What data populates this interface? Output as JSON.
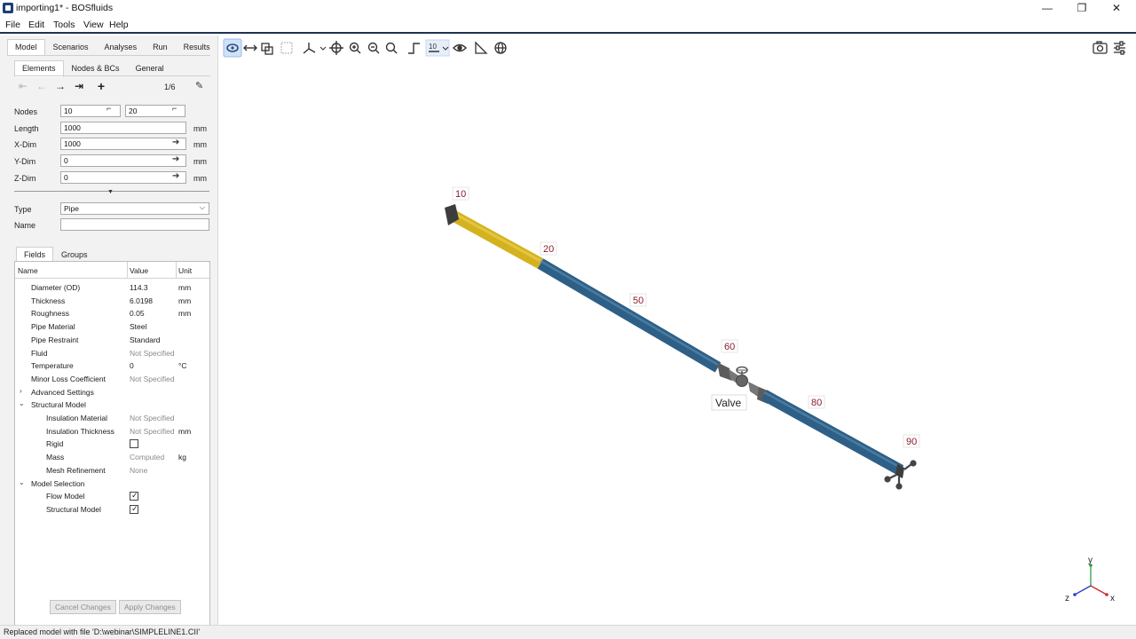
{
  "window": {
    "title": "importing1* - BOSfluids",
    "minimize_glyph": "—",
    "maximize_glyph": "❐",
    "close_glyph": "✕"
  },
  "menu": [
    "File",
    "Edit",
    "Tools",
    "View",
    "Help"
  ],
  "left_panel": {
    "main_tabs": [
      "Model",
      "Scenarios",
      "Analyses",
      "Run",
      "Results"
    ],
    "sub_tabs": [
      "Elements",
      "Nodes & BCs",
      "General"
    ],
    "nav": {
      "first": "⇤",
      "prev": "←",
      "next": "→",
      "last": "⇥",
      "add": "+",
      "counter": "1/6",
      "edit": "✎"
    },
    "element": {
      "nodes_label": "Nodes",
      "node_from": "10",
      "node_to": "20",
      "length_label": "Length",
      "length": "1000",
      "length_unit": "mm",
      "xdim_label": "X-Dim",
      "xdim": "1000",
      "xdim_unit": "mm",
      "ydim_label": "Y-Dim",
      "ydim": "0",
      "ydim_unit": "mm",
      "zdim_label": "Z-Dim",
      "zdim": "0",
      "zdim_unit": "mm",
      "arrow_glyph": "➔",
      "collapse_glyph": "▼",
      "type_label": "Type",
      "type_value": "Pipe",
      "type_chevron": "⌵",
      "name_label": "Name",
      "name_value": ""
    },
    "fields_tabs": [
      "Fields",
      "Groups"
    ],
    "table": {
      "headers": [
        "Name",
        "Value",
        "Unit"
      ],
      "rows": [
        {
          "name": "Diameter (OD)",
          "value": "114.3",
          "unit": "mm"
        },
        {
          "name": "Thickness",
          "value": "6.0198",
          "unit": "mm"
        },
        {
          "name": "Roughness",
          "value": "0.05",
          "unit": "mm"
        },
        {
          "name": "Pipe Material",
          "value": "Steel",
          "unit": ""
        },
        {
          "name": "Pipe Restraint",
          "value": "Standard",
          "unit": ""
        },
        {
          "name": "Fluid",
          "value": "Not Specified",
          "unit": ""
        },
        {
          "name": "Temperature",
          "value": "0",
          "unit": "°C"
        },
        {
          "name": "Minor Loss Coefficient",
          "value": "Not Specified",
          "unit": ""
        },
        {
          "name": "Advanced Settings",
          "value": "",
          "unit": ""
        },
        {
          "name": "Structural Model",
          "value": "",
          "unit": ""
        },
        {
          "name": "Insulation Material",
          "value": "Not Specified",
          "unit": ""
        },
        {
          "name": "Insulation Thickness",
          "value": "Not Specified",
          "unit": "mm"
        },
        {
          "name": "Rigid",
          "value": "",
          "unit": ""
        },
        {
          "name": "Mass",
          "value": "Computed",
          "unit": "kg"
        },
        {
          "name": "Mesh Refinement",
          "value": "None",
          "unit": ""
        },
        {
          "name": "Model Selection",
          "value": "",
          "unit": ""
        },
        {
          "name": "Flow Model",
          "value": "",
          "unit": ""
        },
        {
          "name": "Structural Model",
          "value": "",
          "unit": ""
        }
      ],
      "expander_collapsed": "›",
      "expander_expanded": "⌄",
      "rigid_checked": false,
      "flow_model_checked": true,
      "structural_model_checked": true
    },
    "buttons": {
      "cancel": "Cancel Changes",
      "apply": "Apply Changes"
    }
  },
  "toolbar": {
    "icons": [
      "rotate-icon",
      "pan-icon",
      "fit-view-icon",
      "select-box-icon",
      "axes-icon",
      "target-icon",
      "zoom-in-icon",
      "zoom-out-icon",
      "zoom-icon",
      "isometric-icon",
      "node-labels-icon",
      "eye-icon",
      "measure-icon",
      "globe-icon"
    ],
    "right_icons": [
      "camera-icon",
      "settings-icon"
    ]
  },
  "viewport": {
    "node_labels": [
      "10",
      "20",
      "50",
      "60",
      "80",
      "90"
    ],
    "valve_label": "Valve",
    "axes": {
      "x": "x",
      "y": "y",
      "z": "z"
    },
    "colors": {
      "pipe_selected": "#d4b21f",
      "pipe": "#2e5f86",
      "node_label": "#8a1d2e",
      "component": "#5c5c5c"
    }
  },
  "status": "Replaced model with file 'D:\\webinar\\SIMPLELINE1.CII'"
}
